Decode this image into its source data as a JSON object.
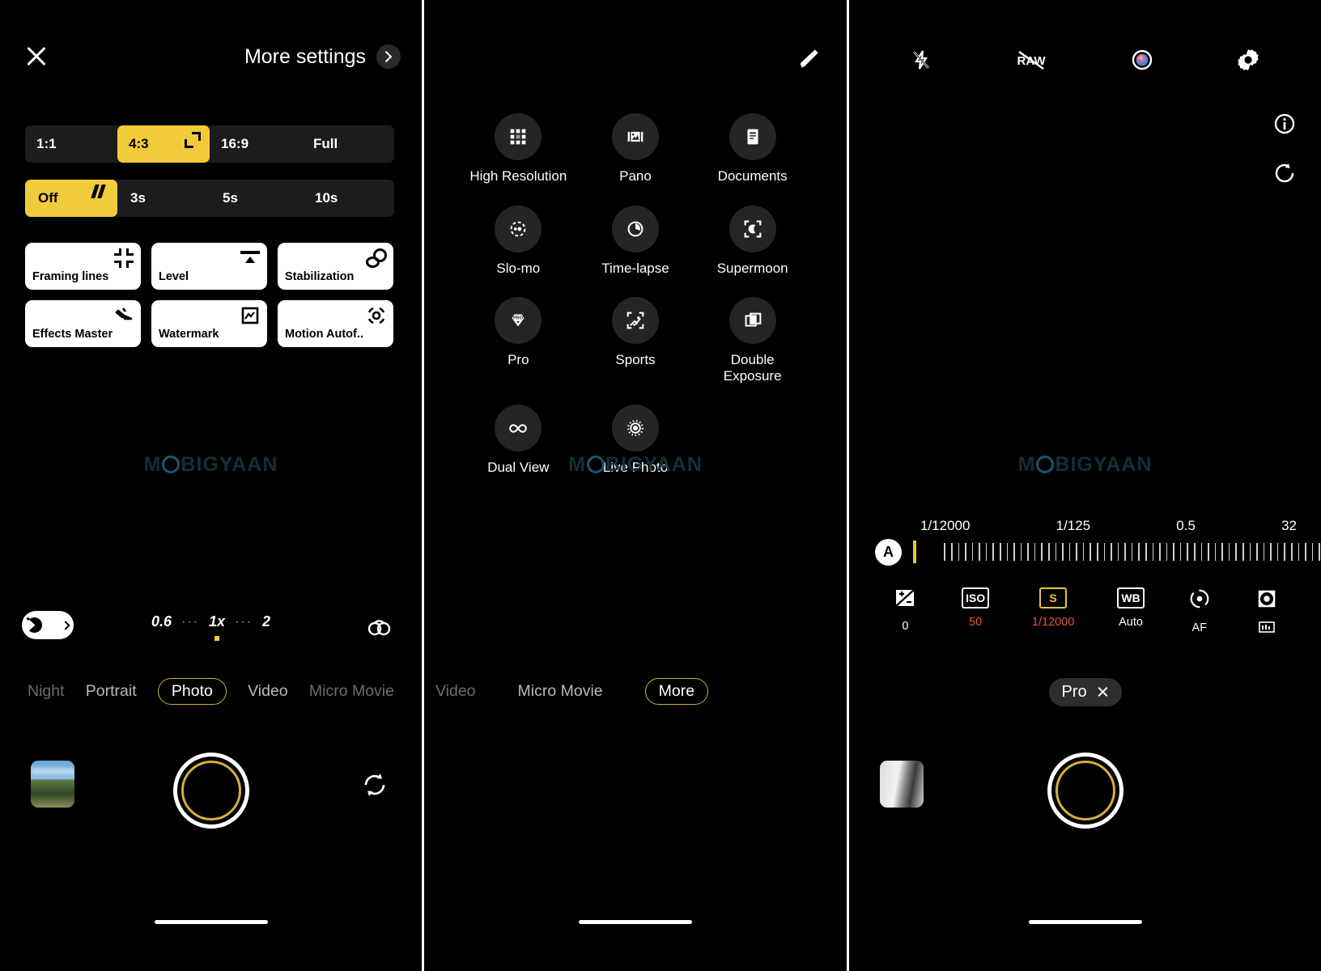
{
  "watermark": {
    "text_left": "M",
    "text_mid": "BIGYAAN"
  },
  "panel1": {
    "header": {
      "close_icon": "close-icon",
      "more_settings_label": "More settings",
      "chevron_icon": "chevron-right-icon"
    },
    "aspect_ratio": {
      "options": [
        "1:1",
        "4:3",
        "16:9",
        "Full"
      ],
      "selected": "4:3",
      "icon": "expand-icon"
    },
    "timer": {
      "options": [
        "Off",
        "3s",
        "5s",
        "10s"
      ],
      "selected": "Off",
      "icon": "timer-off-icon"
    },
    "cards": [
      {
        "label": "Framing lines",
        "icon": "framing-lines-icon"
      },
      {
        "label": "Level",
        "icon": "level-icon"
      },
      {
        "label": "Stabilization",
        "icon": "stabilization-icon"
      },
      {
        "label": "Effects Master",
        "icon": "effects-master-icon"
      },
      {
        "label": "Watermark",
        "icon": "watermark-icon"
      },
      {
        "label": "Motion Autof..",
        "icon": "motion-autofocus-icon"
      }
    ],
    "night_toggle": {
      "icon": "night-mode-icon",
      "chevron": "chevron-right-icon"
    },
    "zoom": {
      "levels": [
        "0.6",
        "1x",
        "2"
      ],
      "selected": "1x",
      "dots": "···"
    },
    "lens_icon": "lens-switch-icon",
    "modes": [
      {
        "label": "Night",
        "state": "dim"
      },
      {
        "label": "Portrait",
        "state": "normal"
      },
      {
        "label": "Photo",
        "state": "selected"
      },
      {
        "label": "Video",
        "state": "normal"
      },
      {
        "label": "Micro Movie",
        "state": "dim"
      }
    ],
    "bottom": {
      "thumbnail": "gallery-thumbnail",
      "shutter": "shutter-button",
      "flip": "flip-camera-icon"
    }
  },
  "panel2": {
    "edit_icon": "edit-pencil-icon",
    "modes": [
      {
        "label": "High Resolution",
        "icon": "high-resolution-icon"
      },
      {
        "label": "Pano",
        "icon": "panorama-icon"
      },
      {
        "label": "Documents",
        "icon": "documents-icon"
      },
      {
        "label": "Slo-mo",
        "icon": "slow-motion-icon"
      },
      {
        "label": "Time-lapse",
        "icon": "time-lapse-icon"
      },
      {
        "label": "Supermoon",
        "icon": "supermoon-icon"
      },
      {
        "label": "Pro",
        "icon": "pro-icon"
      },
      {
        "label": "Sports",
        "icon": "sports-icon"
      },
      {
        "label": "Double Exposure",
        "icon": "double-exposure-icon"
      },
      {
        "label": "Dual View",
        "icon": "dual-view-icon"
      },
      {
        "label": "Live Photo",
        "icon": "live-photo-icon"
      }
    ],
    "mode_bar": [
      {
        "label": "Video",
        "state": "dim"
      },
      {
        "label": "Micro Movie",
        "state": "normal"
      },
      {
        "label": "More",
        "state": "selected"
      }
    ]
  },
  "panel3": {
    "top_icons": [
      {
        "name": "flash-off-icon"
      },
      {
        "name": "raw-off-icon",
        "label": "RAW"
      },
      {
        "name": "color-filter-icon"
      },
      {
        "name": "settings-gear-icon"
      }
    ],
    "side_icons": [
      {
        "name": "info-icon"
      },
      {
        "name": "histogram-rotate-icon"
      }
    ],
    "shutter_scale": {
      "labels": [
        "1/12000",
        "1/125",
        "0.5",
        "32"
      ],
      "auto_badge": "A",
      "cursor_position_pct": 0
    },
    "controls": [
      {
        "icon": "exposure-compensation-icon",
        "badge": "",
        "value": "0",
        "selected": false,
        "hot": false
      },
      {
        "icon": "iso-icon",
        "badge": "ISO",
        "value": "50",
        "selected": false,
        "hot": true
      },
      {
        "icon": "shutter-speed-icon",
        "badge": "S",
        "value": "1/12000",
        "selected": true,
        "hot": true
      },
      {
        "icon": "white-balance-icon",
        "badge": "WB",
        "value": "Auto",
        "selected": false,
        "hot": false
      },
      {
        "icon": "focus-icon",
        "badge": "",
        "value": "AF",
        "selected": false,
        "hot": false
      },
      {
        "icon": "metering-icon",
        "badge": "",
        "value": "",
        "selected": false,
        "hot": false
      }
    ],
    "pro_pill": {
      "label": "Pro",
      "close_icon": "close-icon"
    },
    "bottom": {
      "thumbnail": "gallery-thumbnail",
      "shutter": "shutter-button"
    }
  }
}
